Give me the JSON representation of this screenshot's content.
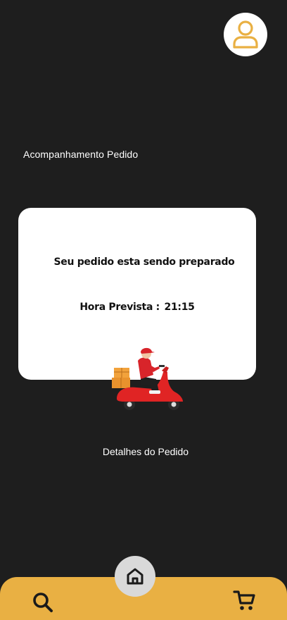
{
  "header": {
    "profile_icon": "user-icon",
    "accent_color": "#e9b043"
  },
  "tracking": {
    "title": "Acompanhamento Pedido",
    "status_message": "Seu pedido esta sendo preparado",
    "eta_label": "Hora Prevista :",
    "eta_value": "21:15",
    "illustration": "delivery-scooter-illustration"
  },
  "details": {
    "link_label": "Detalhes do Pedido"
  },
  "bottom_nav": {
    "background_color": "#e9b043",
    "items": [
      {
        "name": "search",
        "icon": "search-icon"
      },
      {
        "name": "home",
        "icon": "home-icon"
      },
      {
        "name": "cart",
        "icon": "cart-icon"
      }
    ]
  }
}
